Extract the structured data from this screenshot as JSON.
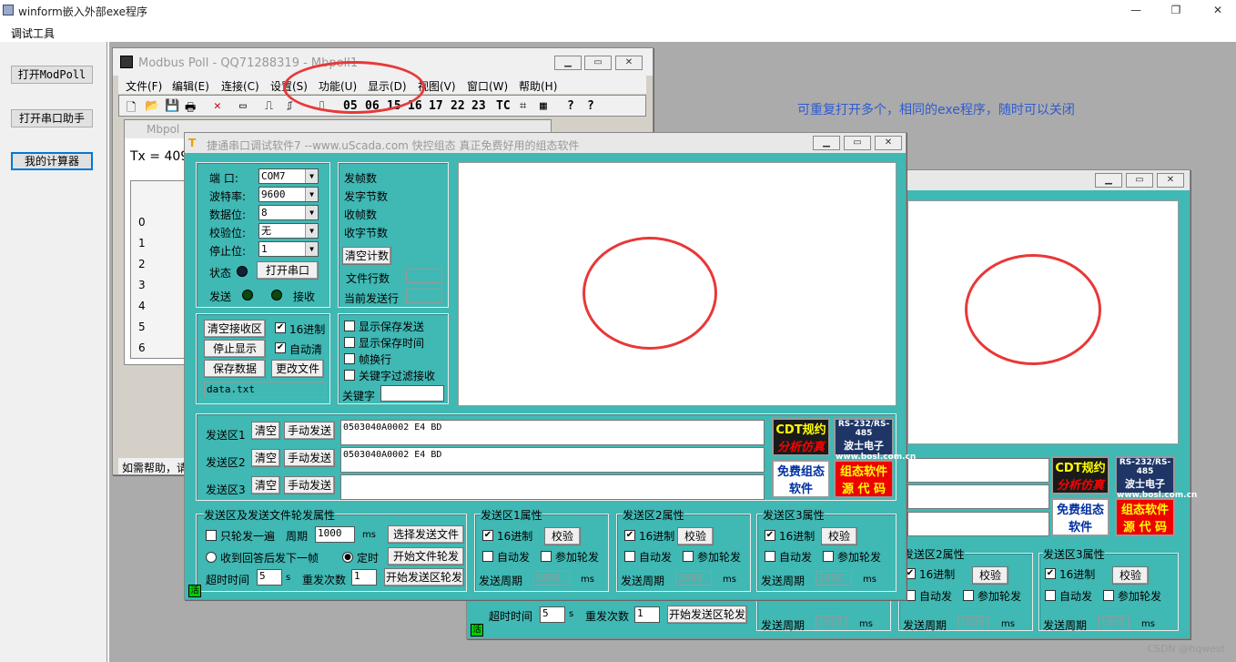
{
  "app": {
    "title": "winform嵌入外部exe程序",
    "menu": "调试工具",
    "note": "可重复打开多个，相同的exe程序，随时可以关闭",
    "watermark": "CSDN @hqwest"
  },
  "left_buttons": [
    "打开ModPoll",
    "打开串口助手",
    "我的计算器"
  ],
  "modbus": {
    "title": "Modbus Poll - QQ71288319 - Mbpoll1",
    "menu": [
      "文件(F)",
      "编辑(E)",
      "连接(C)",
      "设置(S)",
      "功能(U)",
      "显示(D)",
      "视图(V)",
      "窗口(W)",
      "帮助(H)"
    ],
    "codes": [
      "05",
      "06",
      "15",
      "16",
      "17",
      "22",
      "23",
      "TC"
    ],
    "child_title": "Mbpol",
    "tx": "Tx = 409:",
    "rows": [
      "0",
      "1",
      "2",
      "3",
      "4",
      "5",
      "6"
    ],
    "status": "如需帮助，请"
  },
  "serial": {
    "title": "捷通串口调试软件7 --www.uScada.com 快控组态 真正免费好用的组态软件",
    "labels": {
      "port": "端 口:",
      "baud": "波特率:",
      "data": "数据位:",
      "parity": "校验位:",
      "stop": "停止位:",
      "state": "状态",
      "send": "发送",
      "recv": "接收"
    },
    "values": {
      "port": "COM7",
      "baud": "9600",
      "data": "8",
      "parity": "无",
      "stop": "1"
    },
    "open": "打开串口",
    "counts": [
      "发帧数",
      "发字节数",
      "收帧数",
      "收字节数"
    ],
    "clear_count": "清空计数",
    "file_rows": "文件行数",
    "cur_row": "当前发送行",
    "recv_btns": [
      "清空接收区",
      "停止显示",
      "保存数据",
      "更改文件"
    ],
    "hex": "16进制",
    "autoclear": "自动清",
    "filename": "data.txt",
    "opts": [
      "显示保存发送",
      "显示保存时间",
      "帧换行",
      "关键字过滤接收"
    ],
    "keyword": "关键字",
    "send_areas": [
      {
        "label": "发送区1",
        "text": "0503040A0002 E4 BD"
      },
      {
        "label": "发送区2",
        "text": "0503040A0002 E4 BD"
      },
      {
        "label": "发送区3",
        "text": ""
      }
    ],
    "clear": "清空",
    "manual": "手动发送",
    "ads": {
      "cdt1": "CDT规约",
      "cdt2": "分析仿真",
      "bosl1": "RS-232/RS-485",
      "bosl2": "波士电子",
      "bosl3": "www.bosl.com.cn",
      "free1": "免费组态",
      "free2": "软件",
      "src1": "组态软件",
      "src2": "源 代 码"
    },
    "poll": {
      "title": "发送区及发送文件轮发属性",
      "once": "只轮发一遍",
      "period": "周期",
      "period_val": "1000",
      "ms": "ms",
      "choose": "选择发送文件",
      "after": "收到回答后发下一帧",
      "timed": "定时",
      "start_file": "开始文件轮发",
      "timeout": "超时时间",
      "timeout_val": "5",
      "s": "s",
      "retry": "重发次数",
      "retry_val": "1",
      "start_area": "开始发送区轮发"
    },
    "props": [
      {
        "title": "发送区1属性"
      },
      {
        "title": "发送区2属性"
      },
      {
        "title": "发送区3属性"
      }
    ],
    "check": "校验",
    "auto": "自动发",
    "join": "参加轮发",
    "sendperiod": "发送周期",
    "pval": "1000",
    "hexl": "16进制",
    "live": "活"
  }
}
